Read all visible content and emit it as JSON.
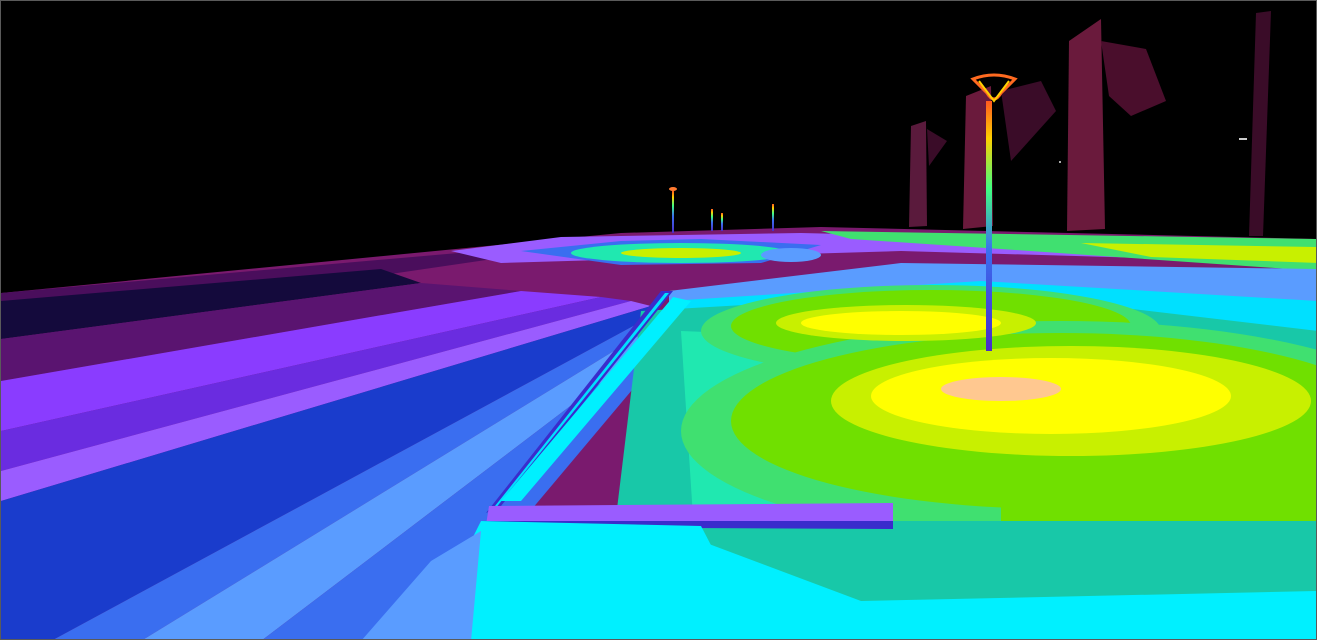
{
  "scene": {
    "description_visible_text": "",
    "palette": {
      "sky": "#000000",
      "low": "#140a3c",
      "dark_purple": "#4a0e5c",
      "magenta": "#7a1a6e",
      "purple": "#8a3cff",
      "violet": "#9a5cff",
      "blue": "#3a6ef0",
      "light_blue": "#5a9cff",
      "cyan": "#00f0ff",
      "teal": "#18c8a8",
      "aqua": "#20e8b0",
      "green": "#40e070",
      "lime": "#70e000",
      "yellow_green": "#c8f000",
      "yellow": "#ffff00",
      "peak": "#ffc890",
      "building": "#6a1a3c",
      "pole": "#4a3cff"
    },
    "icons": [
      "street-lamp-icon",
      "building-icon"
    ]
  }
}
